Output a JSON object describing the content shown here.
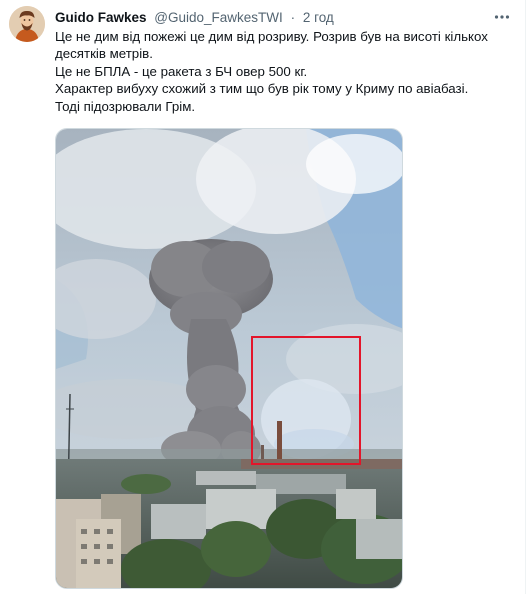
{
  "tweet": {
    "author_name": "Guido Fawkes",
    "author_handle": "@Guido_FawkesTWI",
    "separator": "·",
    "time": "2 год",
    "text_lines": [
      "Це не дим від пожежі це дим від розриву. Розрив був на висоті кількох",
      "десятків метрів.",
      "Це не БПЛА - це ракета з БЧ овер 500 кг.",
      "Характер вибуху схожий з тим що був рік тому у Криму по авіабазі.",
      "Тоді підозрювали Грім."
    ]
  },
  "icons": {
    "more": "more-horizontal-icon",
    "avatar": "profile-avatar"
  },
  "colors": {
    "text_primary": "#0f1419",
    "text_secondary": "#536471",
    "highlight_box": "#e3152a"
  }
}
